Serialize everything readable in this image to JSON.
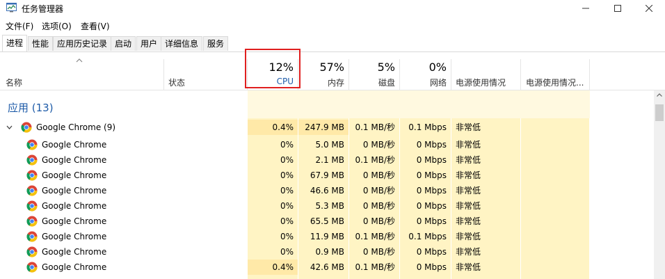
{
  "window": {
    "title": "任务管理器",
    "minimize_icon": "minimize-icon",
    "maximize_icon": "maximize-icon",
    "close_icon": "close-icon"
  },
  "menu": [
    "文件(F)",
    "选项(O)",
    "查看(V)"
  ],
  "tabs": [
    "进程",
    "性能",
    "应用历史记录",
    "启动",
    "用户",
    "详细信息",
    "服务"
  ],
  "active_tab": "进程",
  "header": {
    "name": "名称",
    "status": "状态",
    "cpu_pct": "12%",
    "cpu": "CPU",
    "mem_pct": "57%",
    "mem": "内存",
    "disk_pct": "5%",
    "disk": "磁盘",
    "net_pct": "0%",
    "net": "网络",
    "power": "电源使用情况",
    "power_trend": "电源使用情况..."
  },
  "group": {
    "title": "应用 (13)"
  },
  "parent": {
    "name": "Google Chrome (9)",
    "cpu": "0.4%",
    "mem": "247.9 MB",
    "disk": "0.1 MB/秒",
    "net": "0.1 Mbps",
    "power": "非常低"
  },
  "children": [
    {
      "name": "Google Chrome",
      "cpu": "0%",
      "mem": "5.0 MB",
      "disk": "0 MB/秒",
      "net": "0 Mbps",
      "power": "非常低"
    },
    {
      "name": "Google Chrome",
      "cpu": "0%",
      "mem": "2.1 MB",
      "disk": "0.1 MB/秒",
      "net": "0 Mbps",
      "power": "非常低"
    },
    {
      "name": "Google Chrome",
      "cpu": "0%",
      "mem": "67.9 MB",
      "disk": "0 MB/秒",
      "net": "0 Mbps",
      "power": "非常低"
    },
    {
      "name": "Google Chrome",
      "cpu": "0%",
      "mem": "46.6 MB",
      "disk": "0 MB/秒",
      "net": "0 Mbps",
      "power": "非常低"
    },
    {
      "name": "Google Chrome",
      "cpu": "0%",
      "mem": "5.3 MB",
      "disk": "0 MB/秒",
      "net": "0 Mbps",
      "power": "非常低"
    },
    {
      "name": "Google Chrome",
      "cpu": "0%",
      "mem": "65.5 MB",
      "disk": "0 MB/秒",
      "net": "0 Mbps",
      "power": "非常低"
    },
    {
      "name": "Google Chrome",
      "cpu": "0%",
      "mem": "11.9 MB",
      "disk": "0.1 MB/秒",
      "net": "0.1 Mbps",
      "power": "非常低"
    },
    {
      "name": "Google Chrome",
      "cpu": "0%",
      "mem": "0.9 MB",
      "disk": "0 MB/秒",
      "net": "0 Mbps",
      "power": "非常低"
    },
    {
      "name": "Google Chrome",
      "cpu": "0.4%",
      "mem": "42.6 MB",
      "disk": "0.1 MB/秒",
      "net": "0 Mbps",
      "power": "非常低"
    }
  ],
  "colors": {
    "heat_light": "#fff4c4",
    "heat_mid": "#ffe9a8",
    "heat_header": "#fff9e0",
    "group_title": "#1e5ba8",
    "highlight_box": "#e01f1f"
  }
}
